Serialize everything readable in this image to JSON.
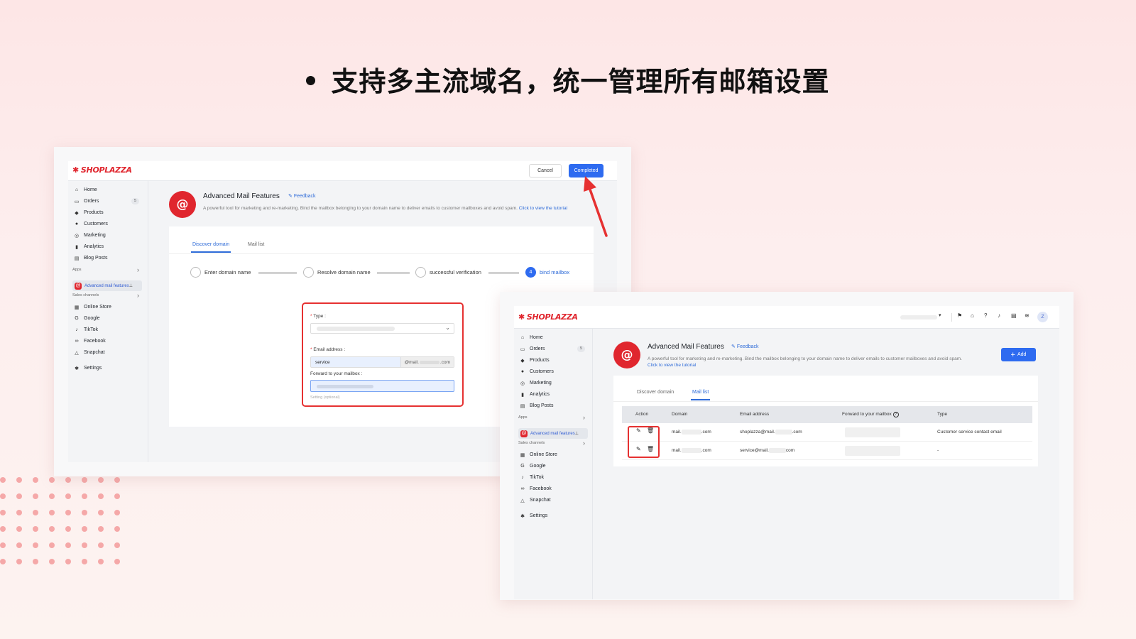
{
  "headline": "支持多主流域名，统一管理所有邮箱设置",
  "brand": {
    "logo_text": "SHOPLAZZA",
    "accent": "#e0262e",
    "primary": "#2e6bf0",
    "highlight": "#e63131"
  },
  "nav": {
    "items": [
      {
        "key": "home",
        "icon": "home-icon",
        "label": "Home"
      },
      {
        "key": "orders",
        "icon": "orders-icon",
        "label": "Orders",
        "badge": "5"
      },
      {
        "key": "products",
        "icon": "tag-icon",
        "label": "Products"
      },
      {
        "key": "customers",
        "icon": "user-icon",
        "label": "Customers"
      },
      {
        "key": "marketing",
        "icon": "marketing-icon",
        "label": "Marketing"
      },
      {
        "key": "analytics",
        "icon": "bar-chart-icon",
        "label": "Analytics"
      },
      {
        "key": "blog",
        "icon": "blog-icon",
        "label": "Blog Posts"
      }
    ],
    "apps_label": "Apps",
    "app_item": "Advanced mail features",
    "sales_label": "Sales channels",
    "channels": [
      {
        "key": "online",
        "icon": "store-icon",
        "label": "Online Store"
      },
      {
        "key": "google",
        "icon": "google-icon",
        "label": "Google"
      },
      {
        "key": "tiktok",
        "icon": "tiktok-icon",
        "label": "TikTok"
      },
      {
        "key": "facebook",
        "icon": "meta-icon",
        "label": "Facebook"
      },
      {
        "key": "snapchat",
        "icon": "ghost-icon",
        "label": "Snapchat"
      }
    ],
    "settings": "Settings"
  },
  "page": {
    "title": "Advanced Mail Features",
    "feedback": "Feedback",
    "description": "A powerful tool for marketing and re-marketing. Bind the mailbox belonging to your domain name to deliver emails to customer mailboxes and avoid spam.",
    "tutorial_link": "Click to view the tutorial",
    "tabs": [
      "Discover domain",
      "Mail list"
    ]
  },
  "screen1": {
    "cancel": "Cancel",
    "completed": "Completed",
    "steps": [
      "Enter domain name",
      "Resolve domain name",
      "successful verification",
      "bind mailbox"
    ],
    "active_step_number": "4",
    "form": {
      "type_label": "Type :",
      "email_label": "Email address :",
      "email_value": "service",
      "email_suffix_prefix": "@mail.",
      "email_suffix_end": ".com",
      "forward_label": "Forward to your mailbox :",
      "hint": "Setting (optional)"
    }
  },
  "screen2": {
    "add": "Add",
    "columns": [
      "Action",
      "Domain",
      "Email address",
      "Forward to your mailbox",
      "Type"
    ],
    "rows": [
      {
        "domain_a": "mail.",
        "domain_b": ".com",
        "email_a": "shoplazza@mail.",
        "email_b": ".com",
        "type": "Customer service contact email"
      },
      {
        "domain_a": "mail.",
        "domain_b": ".com",
        "email_a": "service@mail.",
        "email_b": "com",
        "type": "-"
      }
    ],
    "avatar_letter": "Z"
  }
}
